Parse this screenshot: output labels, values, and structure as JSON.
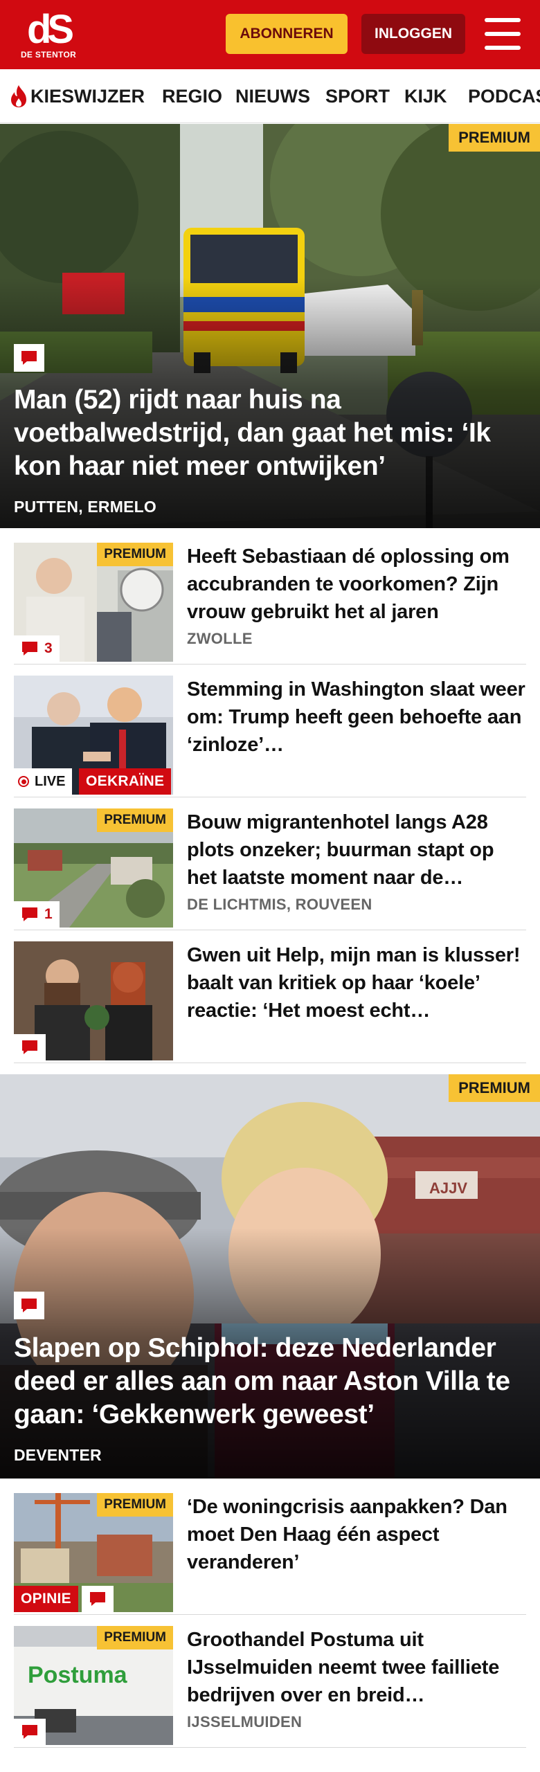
{
  "header": {
    "logo_mark": "dS",
    "logo_sub": "DE STENTOR",
    "subscribe_label": "ABONNEREN",
    "login_label": "INLOGGEN",
    "brand_color": "#d10a11",
    "accent_color": "#f9c12e"
  },
  "nav": {
    "items": [
      "KIESWIJZER",
      "REGIO",
      "NIEUWS",
      "SPORT",
      "KIJK",
      "PODCASTS"
    ]
  },
  "hero1": {
    "badge": "PREMIUM",
    "title": "Man (52) rijdt naar huis na voetbalwedstrijd, dan gaat het mis: ‘Ik kon haar niet meer ontwijken’",
    "location": "PUTTEN, ERMELO"
  },
  "list1": [
    {
      "badge": "PREMIUM",
      "comments": "3",
      "title": "Heeft Sebastiaan dé oplossing om accubranden te voorkomen? Zijn vrouw gebruikt het al jaren",
      "location": "ZWOLLE"
    },
    {
      "live_label": "LIVE",
      "tag": "OEKRAÏNE",
      "title": "Stemming in Washington slaat weer om: Trump heeft geen behoefte aan ‘zinloze’…"
    },
    {
      "badge": "PREMIUM",
      "comments": "1",
      "title": "Bouw migrantenhotel langs A28 plots onzeker; buurman stapt op het laatste moment naar de…",
      "location": "DE LICHTMIS, ROUVEEN"
    },
    {
      "title": "Gwen uit Help, mijn man is klusser! baalt van kritiek op haar ‘koele’ reactie: ‘Het moest echt…"
    }
  ],
  "hero2": {
    "badge": "PREMIUM",
    "title": "Slapen op Schiphol: deze Nederlander deed er alles aan om naar Aston Villa te gaan: ‘Gekkenwerk geweest’",
    "location": "DEVENTER",
    "stadium_sign": "AJJV"
  },
  "list2": [
    {
      "badge": "PREMIUM",
      "tag": "OPINIE",
      "title": "‘De woningcrisis aanpakken? Dan moet Den Haag één aspect veranderen’"
    },
    {
      "badge": "PREMIUM",
      "brand_text": "Postuma",
      "title": "Groothandel Postuma uit IJsselmuiden neemt twee failliete bedrijven over en breid…",
      "location": "IJSSELMUIDEN"
    }
  ]
}
